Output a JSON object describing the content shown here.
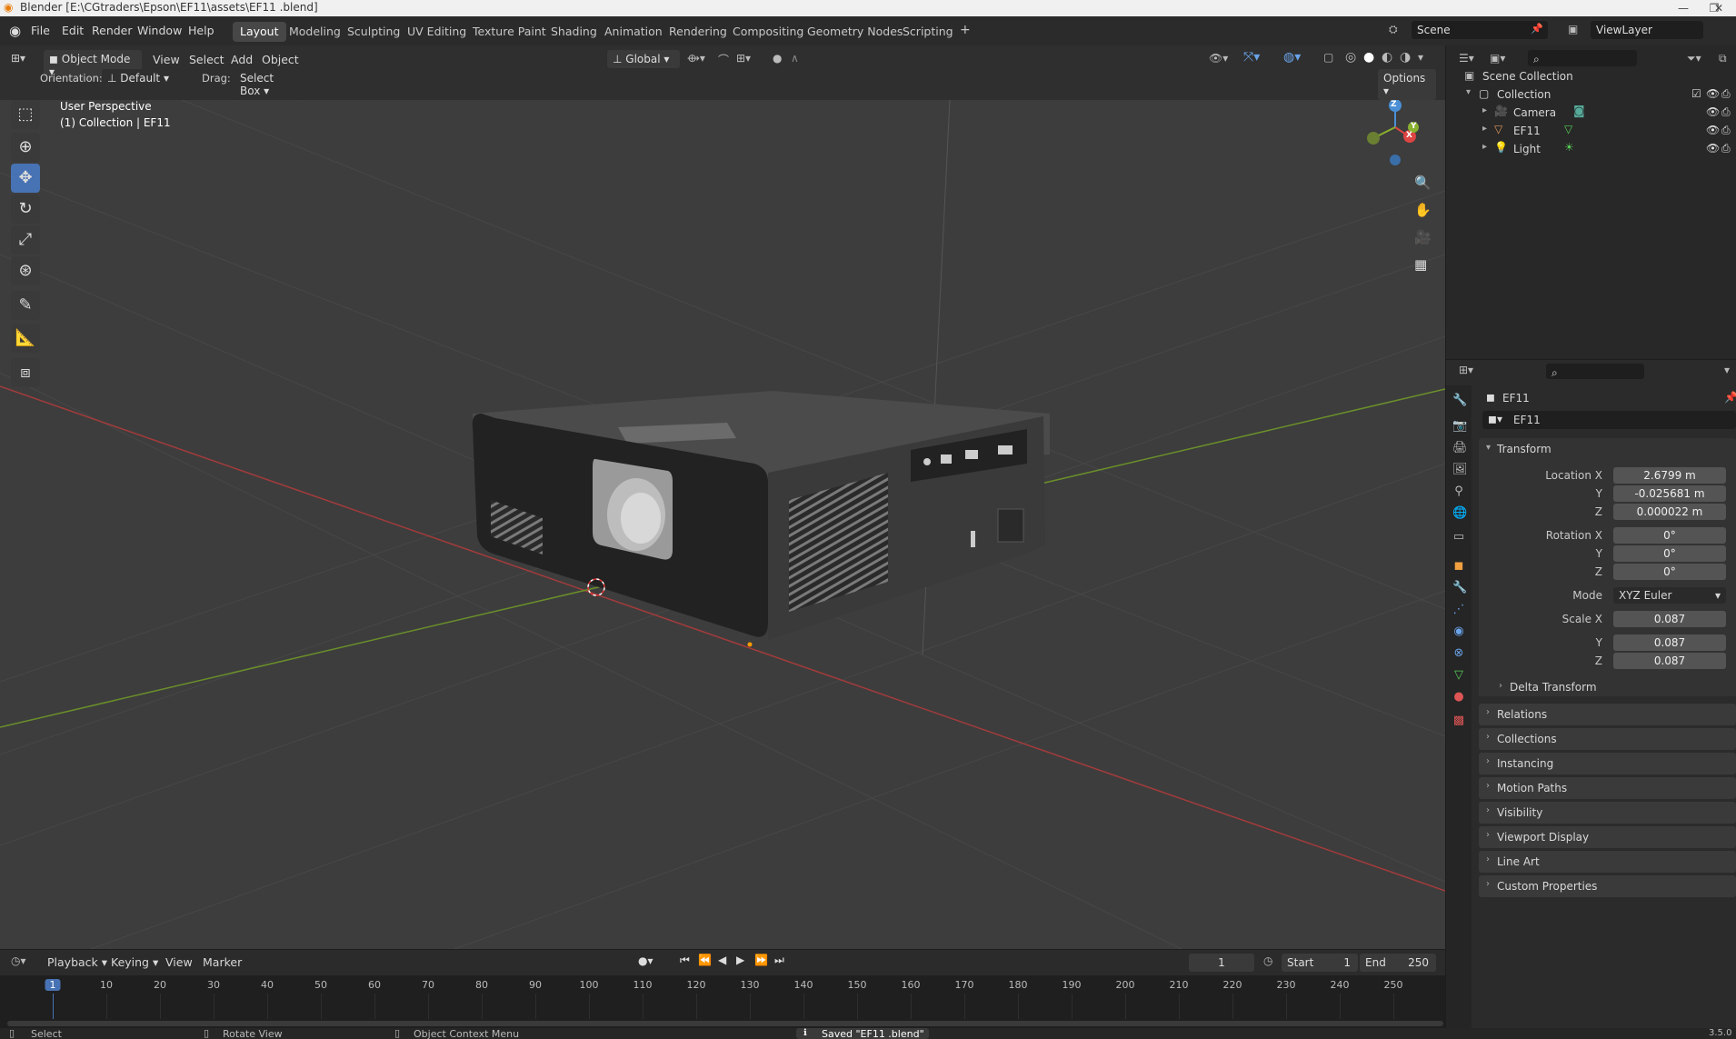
{
  "window": {
    "title": "Blender [E:\\CGtraders\\Epson\\EF11\\assets\\EF11 .blend]"
  },
  "menu": [
    "File",
    "Edit",
    "Render",
    "Window",
    "Help"
  ],
  "workspaces": [
    "Layout",
    "Modeling",
    "Sculpting",
    "UV Editing",
    "Texture Paint",
    "Shading",
    "Animation",
    "Rendering",
    "Compositing",
    "Geometry Nodes",
    "Scripting"
  ],
  "scene": "Scene",
  "view_layer": "ViewLayer",
  "viewport_header": {
    "mode": "Object Mode",
    "menus": [
      "View",
      "Select",
      "Add",
      "Object"
    ],
    "transform_orientation": "Global",
    "orientation_label": "Orientation:",
    "orientation_value": "Default",
    "drag_label": "Drag:",
    "drag_value": "Select Box",
    "options": "Options"
  },
  "viewport": {
    "perspective": "User Perspective",
    "collection_info": "(1) Collection | EF11",
    "gizmo": {
      "x": "X",
      "y": "Y",
      "z": "Z"
    }
  },
  "outliner": {
    "root": "Scene Collection",
    "collection": "Collection",
    "items": [
      "Camera",
      "EF11",
      "Light"
    ]
  },
  "properties": {
    "object_name": "EF11",
    "data_name": "EF11",
    "transform_title": "Transform",
    "location": {
      "label": "Location X",
      "x": "2.6799 m",
      "y": "-0.025681 m",
      "z": "0.000022 m"
    },
    "rotation": {
      "label": "Rotation X",
      "x": "0°",
      "y": "0°",
      "z": "0°"
    },
    "mode_label": "Mode",
    "mode_value": "XYZ Euler",
    "scale": {
      "label": "Scale X",
      "x": "0.087",
      "y": "0.087",
      "z": "0.087"
    },
    "axis_y": "Y",
    "axis_z": "Z",
    "delta_transform": "Delta Transform",
    "panels": [
      "Relations",
      "Collections",
      "Instancing",
      "Motion Paths",
      "Visibility",
      "Viewport Display",
      "Line Art",
      "Custom Properties"
    ]
  },
  "timeline": {
    "menus": [
      "Playback",
      "Keying",
      "View",
      "Marker"
    ],
    "current_frame": "1",
    "start_label": "Start",
    "start": "1",
    "end_label": "End",
    "end": "250",
    "ticks": [
      "1",
      "10",
      "20",
      "30",
      "40",
      "50",
      "60",
      "70",
      "80",
      "90",
      "100",
      "110",
      "120",
      "130",
      "140",
      "150",
      "160",
      "170",
      "180",
      "190",
      "200",
      "210",
      "220",
      "230",
      "240",
      "250"
    ]
  },
  "statusbar": {
    "select": "Select",
    "rotate": "Rotate View",
    "context": "Object Context Menu",
    "message": "Saved \"EF11 .blend\"",
    "version": "3.5.0"
  }
}
